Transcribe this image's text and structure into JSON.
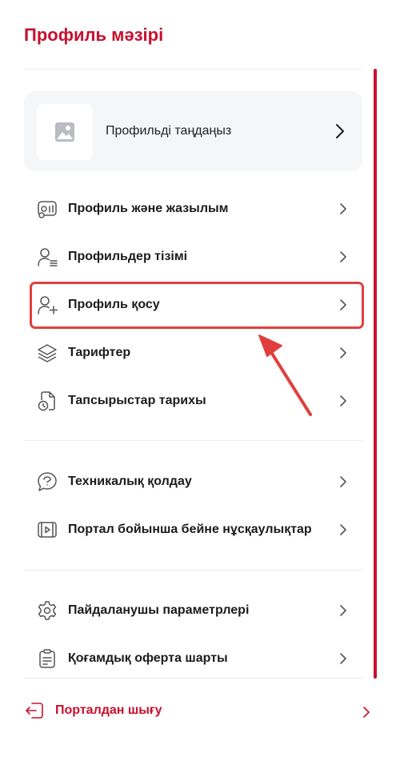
{
  "header": {
    "title": "Профиль мәзірі"
  },
  "profile_card": {
    "label": "Профильді таңдаңыз",
    "icon": "image-placeholder-icon"
  },
  "menu": {
    "items": [
      {
        "label": "Профиль және жазылым",
        "icon": "subscription-card-icon"
      },
      {
        "label": "Профильдер тізімі",
        "icon": "user-list-icon"
      },
      {
        "label": "Профиль қосу",
        "icon": "user-add-icon"
      },
      {
        "label": "Тарифтер",
        "icon": "layers-icon"
      },
      {
        "label": "Тапсырыстар тарихы",
        "icon": "order-history-icon"
      },
      {
        "label": "Техникалық қолдау",
        "icon": "support-chat-icon"
      },
      {
        "label": "Портал бойынша бейне нұсқаулықтар",
        "icon": "video-guide-icon"
      },
      {
        "label": "Пайдаланушы параметрлері",
        "icon": "settings-gear-icon"
      },
      {
        "label": "Қоғамдық оферта шарты",
        "icon": "clipboard-document-icon"
      }
    ]
  },
  "logout": {
    "label": "Порталдан шығу",
    "icon": "logout-icon"
  },
  "colors": {
    "accent": "#c8102e",
    "highlight": "#e0403d",
    "card_bg": "#f5f6f7",
    "divider": "#ebebeb"
  }
}
